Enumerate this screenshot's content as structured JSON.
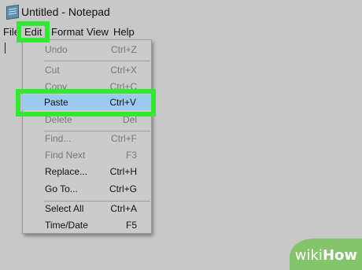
{
  "window": {
    "title": "Untitled - Notepad"
  },
  "menubar": {
    "file": "File",
    "edit": "Edit",
    "format": "Format",
    "view": "View",
    "help": "Help"
  },
  "edit_menu": {
    "undo": {
      "label": "Undo",
      "shortcut": "Ctrl+Z"
    },
    "cut": {
      "label": "Cut",
      "shortcut": "Ctrl+X"
    },
    "copy": {
      "label": "Copy",
      "shortcut": "Ctrl+C"
    },
    "paste": {
      "label": "Paste",
      "shortcut": "Ctrl+V"
    },
    "delete": {
      "label": "Delete",
      "shortcut": "Del"
    },
    "find": {
      "label": "Find...",
      "shortcut": "Ctrl+F"
    },
    "find_next": {
      "label": "Find Next",
      "shortcut": "F3"
    },
    "replace": {
      "label": "Replace...",
      "shortcut": "Ctrl+H"
    },
    "goto": {
      "label": "Go To...",
      "shortcut": "Ctrl+G"
    },
    "select_all": {
      "label": "Select All",
      "shortcut": "Ctrl+A"
    },
    "time_date": {
      "label": "Time/Date",
      "shortcut": "F5"
    }
  },
  "watermark": {
    "part1": "wiki",
    "part2": "How"
  },
  "colors": {
    "highlight_green": "#33e833",
    "paste_selection": "#9cc9ee",
    "watermark_green": "#84c46a"
  }
}
